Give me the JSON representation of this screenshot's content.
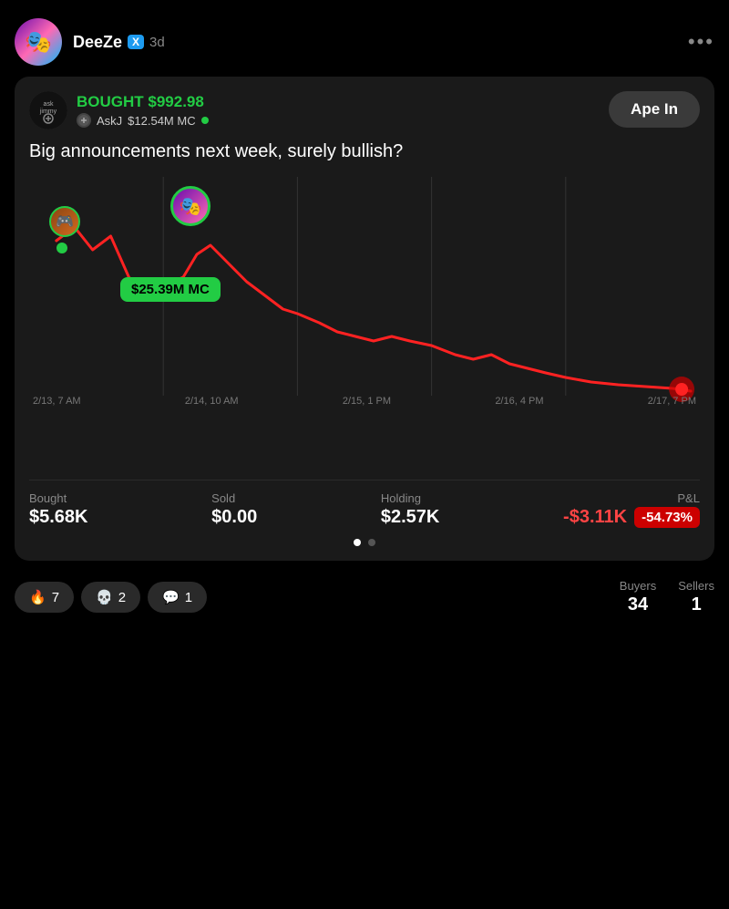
{
  "header": {
    "username": "DeeZe",
    "x_badge": "X",
    "time_ago": "3d",
    "more_dots": "•••",
    "avatar_emoji": "🎭"
  },
  "card": {
    "token_avatar_text": "ask\njimmy",
    "bought_label": "BOUGHT $992.98",
    "token_name": "AskJ",
    "market_cap": "$12.54M MC",
    "ape_btn": "Ape In",
    "caption": "Big announcements next week, surely bullish?",
    "mc_bubble": "$25.39M MC",
    "x_axis": [
      "2/13, 7 AM",
      "2/14, 10 AM",
      "2/15, 1 PM",
      "2/16, 4 PM",
      "2/17, 7 PM"
    ],
    "stats": {
      "bought_label": "Bought",
      "bought_value": "$5.68K",
      "sold_label": "Sold",
      "sold_value": "$0.00",
      "holding_label": "Holding",
      "holding_value": "$2.57K",
      "pnl_label": "P&L",
      "pnl_value": "-$3.11K",
      "pnl_pct": "-54.73%"
    },
    "pagination": [
      true,
      false
    ]
  },
  "footer": {
    "fire_count": "7",
    "skull_count": "2",
    "comment_count": "1",
    "buyers_label": "Buyers",
    "buyers_value": "34",
    "sellers_label": "Sellers",
    "sellers_value": "1"
  },
  "colors": {
    "green": "#22cc44",
    "red": "#ff4444",
    "brand_blue": "#1d9bf0",
    "card_bg": "#1a1a1a"
  }
}
